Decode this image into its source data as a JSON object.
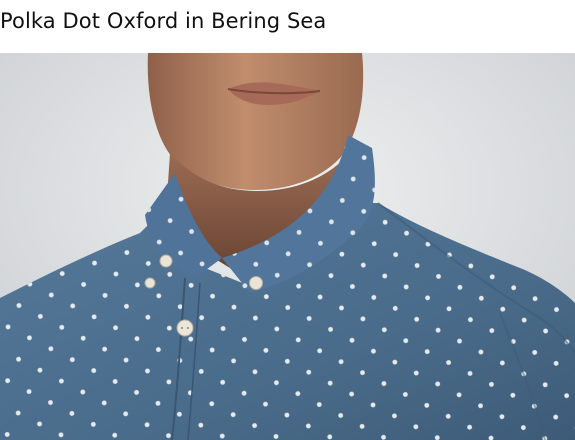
{
  "product": {
    "title": "Polka Dot Oxford in Bering Sea"
  },
  "photo": {
    "subject": "model-wearing-shirt",
    "colors": {
      "background": "#d9dadb",
      "skin": "#b88566",
      "shirt": "#4b6d8c",
      "dots": "#eef1f4"
    }
  }
}
